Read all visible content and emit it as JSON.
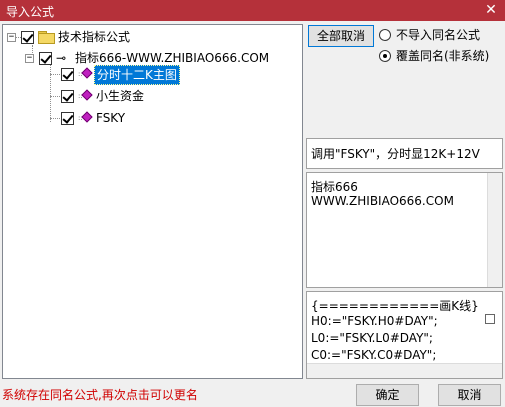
{
  "window": {
    "title": "导入公式",
    "close": "✕"
  },
  "tree": {
    "root": {
      "label": "技术指标公式",
      "expander": "−"
    },
    "child": {
      "label": "指标666-WWW.ZHIBIAO666.COM",
      "expander": "−",
      "key_glyph": "⊸"
    },
    "items": [
      {
        "label": "分时十二K主图",
        "selected": true
      },
      {
        "label": "小生资金",
        "selected": false
      },
      {
        "label": "FSKY",
        "selected": false
      }
    ]
  },
  "actions": {
    "cancel_all": "全部取消",
    "option_skip": "不导入同名公式",
    "option_overwrite": "覆盖同名(非系统)",
    "selected_option": "option_overwrite"
  },
  "info": {
    "usage": "调用\"FSKY\"，分时显12K+12V",
    "desc_lines": [
      "指标666",
      "WWW.ZHIBIAO666.COM"
    ],
    "code_lines": [
      "{============画K线}",
      "H0:=\"FSKY.H0#DAY\";",
      "L0:=\"FSKY.L0#DAY\";",
      "C0:=\"FSKY.C0#DAY\";"
    ]
  },
  "footer": {
    "status": "系统存在同名公式,再次点击可以更名",
    "ok": "确定",
    "cancel": "取消"
  }
}
